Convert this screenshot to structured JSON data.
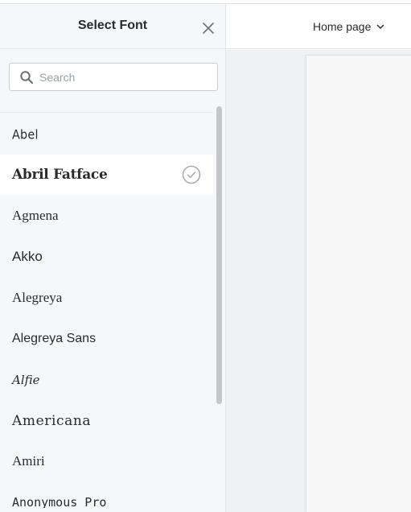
{
  "panel": {
    "title": "Select Font",
    "close_icon": "close-icon"
  },
  "search": {
    "placeholder": "Search",
    "value": "",
    "icon": "search-icon"
  },
  "fonts": {
    "selected": "Abril Fatface",
    "items": [
      {
        "label": "Abel"
      },
      {
        "label": "Abril Fatface"
      },
      {
        "label": "Agmena"
      },
      {
        "label": "Akko"
      },
      {
        "label": "Alegreya"
      },
      {
        "label": "Alegreya Sans"
      },
      {
        "label": "Alfie"
      },
      {
        "label": "Americana"
      },
      {
        "label": "Amiri"
      },
      {
        "label": "Anonymous Pro"
      }
    ]
  },
  "topbar": {
    "page_select_label": "Home page",
    "chevron_icon": "chevron-down-icon"
  },
  "colors": {
    "panel_bg": "#f6f7f9",
    "selected_row": "#ffffff",
    "text": "#2b2b2b",
    "check": "#a9adb2"
  }
}
